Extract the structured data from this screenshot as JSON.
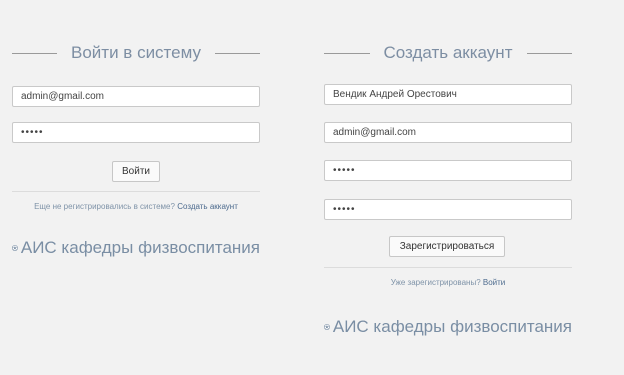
{
  "login": {
    "heading": "Войти в систему",
    "email_value": "admin@gmail.com",
    "password_value": "•••••",
    "submit_label": "Войти",
    "prompt_text": "Еще не регистрировались в системе?",
    "prompt_link": "Создать аккаунт",
    "brand": "АИС кафедры физвоспитания"
  },
  "register": {
    "heading": "Создать аккаунт",
    "name_value": "Вендик Андрей Орестович",
    "email_value": "admin@gmail.com",
    "password_value": "•••••",
    "password_confirm_value": "•••••",
    "submit_label": "Зарегистрироваться",
    "prompt_text": "Уже зарегистрированы?",
    "prompt_link": "Войти",
    "brand": "АИС кафедры физвоспитания"
  },
  "icons": {
    "brand_icon": "soccer-ball-icon"
  },
  "colors": {
    "heading": "#7d8ea3",
    "link": "#4d6b8e",
    "background": "#f2f2f2"
  }
}
